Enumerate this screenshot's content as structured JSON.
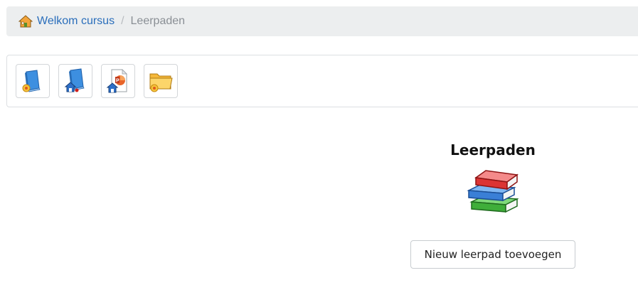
{
  "breadcrumb": {
    "home_label": "Welkom cursus",
    "separator": "/",
    "current": "Leerpaden",
    "home_icon": "home-icon",
    "link_color": "#2a6ebb"
  },
  "toolbar": {
    "buttons": [
      {
        "icon": "new-learnpath-icon"
      },
      {
        "icon": "import-learnpath-icon"
      },
      {
        "icon": "import-powerpoint-icon"
      },
      {
        "icon": "new-category-folder-icon"
      }
    ]
  },
  "main": {
    "title": "Leerpaden",
    "illustration_icon": "books-stack-icon",
    "add_button_label": "Nieuw leerpad toevoegen"
  }
}
